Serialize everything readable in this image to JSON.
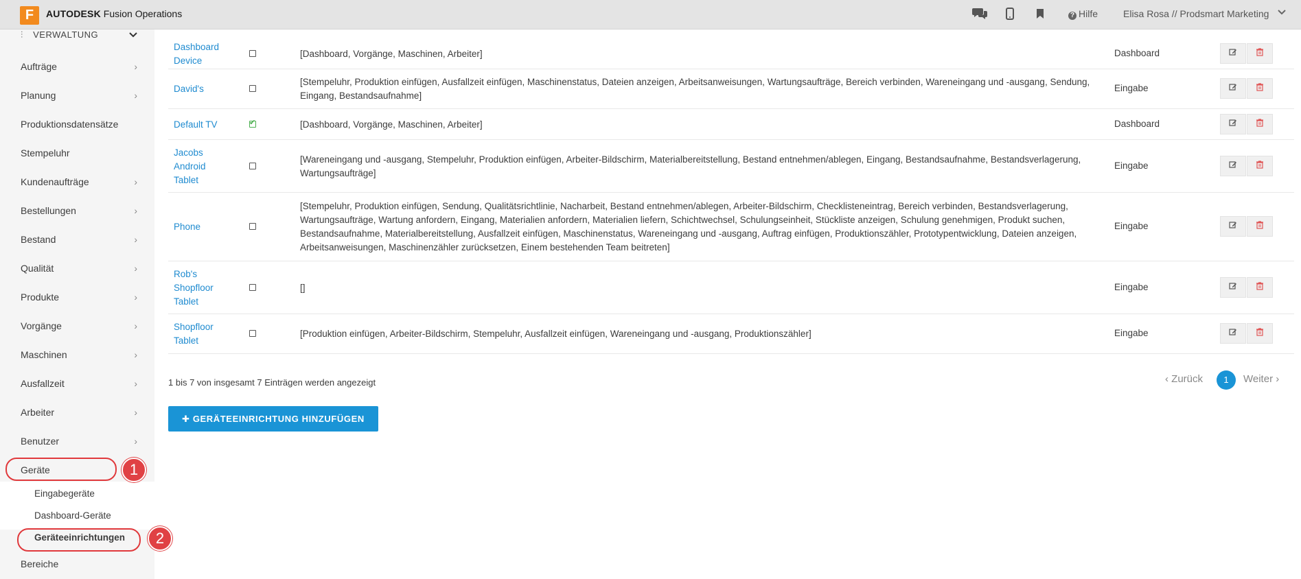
{
  "topbar": {
    "logo_letter": "F",
    "brand_bold": "AUTODESK",
    "brand_rest": "Fusion Operations",
    "help_label": "Hilfe",
    "user_label": "Elisa Rosa // Prodsmart Marketing",
    "icons": [
      "chat-icon",
      "mobile-icon",
      "bookmark-icon",
      "help-icon",
      "chevron-down-icon"
    ]
  },
  "sidebar": {
    "header": "VERWALTUNG",
    "items": [
      {
        "label": "Aufträge",
        "has_chevron": true
      },
      {
        "label": "Planung",
        "has_chevron": true
      },
      {
        "label": "Produktionsdatensätze",
        "has_chevron": false
      },
      {
        "label": "Stempeluhr",
        "has_chevron": false
      },
      {
        "label": "Kundenaufträge",
        "has_chevron": true
      },
      {
        "label": "Bestellungen",
        "has_chevron": true
      },
      {
        "label": "Bestand",
        "has_chevron": true
      },
      {
        "label": "Qualität",
        "has_chevron": true
      },
      {
        "label": "Produkte",
        "has_chevron": true
      },
      {
        "label": "Vorgänge",
        "has_chevron": true
      },
      {
        "label": "Maschinen",
        "has_chevron": true
      },
      {
        "label": "Ausfallzeit",
        "has_chevron": true
      },
      {
        "label": "Arbeiter",
        "has_chevron": true
      },
      {
        "label": "Benutzer",
        "has_chevron": true
      },
      {
        "label": "Geräte",
        "has_chevron": false
      }
    ],
    "subitems": [
      "Eingabegeräte",
      "Dashboard-Geräte",
      "Geräteeinrichtungen"
    ],
    "after": "Bereiche",
    "annotations": [
      "1",
      "2"
    ]
  },
  "table": {
    "rows": [
      {
        "name": "Dashboard Device",
        "active": false,
        "functions": "[Dashboard, Vorgänge, Maschinen, Arbeiter]",
        "type": "Dashboard"
      },
      {
        "name": "David's",
        "active": false,
        "functions": "[Stempeluhr, Produktion einfügen, Ausfallzeit einfügen, Maschinenstatus, Dateien anzeigen, Arbeitsanweisungen, Wartungsaufträge, Bereich verbinden, Wareneingang und -ausgang, Sendung, Eingang, Bestandsaufnahme]",
        "type": "Eingabe"
      },
      {
        "name": "Default TV",
        "active": true,
        "functions": "[Dashboard, Vorgänge, Maschinen, Arbeiter]",
        "type": "Dashboard"
      },
      {
        "name": "Jacobs Android Tablet",
        "active": false,
        "functions": "[Wareneingang und -ausgang, Stempeluhr, Produktion einfügen, Arbeiter-Bildschirm, Materialbereitstellung, Bestand entnehmen/ablegen, Eingang, Bestandsaufnahme, Bestandsverlagerung, Wartungsaufträge]",
        "type": "Eingabe"
      },
      {
        "name": "Phone",
        "active": false,
        "functions": "[Stempeluhr, Produktion einfügen, Sendung, Qualitätsrichtlinie, Nacharbeit, Bestand entnehmen/ablegen, Arbeiter-Bildschirm, Checklisteneintrag, Bereich verbinden, Bestandsverlagerung, Wartungsaufträge, Wartung anfordern, Eingang, Materialien anfordern, Materialien liefern, Schichtwechsel, Schulungseinheit, Stückliste anzeigen, Schulung genehmigen, Produkt suchen, Bestandsaufnahme, Materialbereitstellung, Ausfallzeit einfügen, Maschinenstatus, Wareneingang und -ausgang, Auftrag einfügen, Produktionszähler, Prototypentwicklung, Dateien anzeigen, Arbeitsanweisungen, Maschinenzähler zurücksetzen, Einem bestehenden Team beitreten]",
        "type": "Eingabe"
      },
      {
        "name": "Rob's Shopfloor Tablet",
        "active": false,
        "functions": "[]",
        "type": "Eingabe"
      },
      {
        "name": "Shopfloor Tablet",
        "active": false,
        "functions": "[Produktion einfügen, Arbeiter-Bildschirm, Stempeluhr, Ausfallzeit einfügen, Wareneingang und -ausgang, Produktionszähler]",
        "type": "Eingabe"
      }
    ],
    "info": "1 bis 7 von insgesamt 7 Einträgen werden angezeigt",
    "pager": {
      "prev": "Zurück",
      "page": "1",
      "next": "Weiter"
    },
    "add_button": "GERÄTEEINRICHTUNG HINZUFÜGEN"
  },
  "colors": {
    "accent": "#1a94d6",
    "annotation": "#e04144",
    "logo": "#f28a1e"
  }
}
